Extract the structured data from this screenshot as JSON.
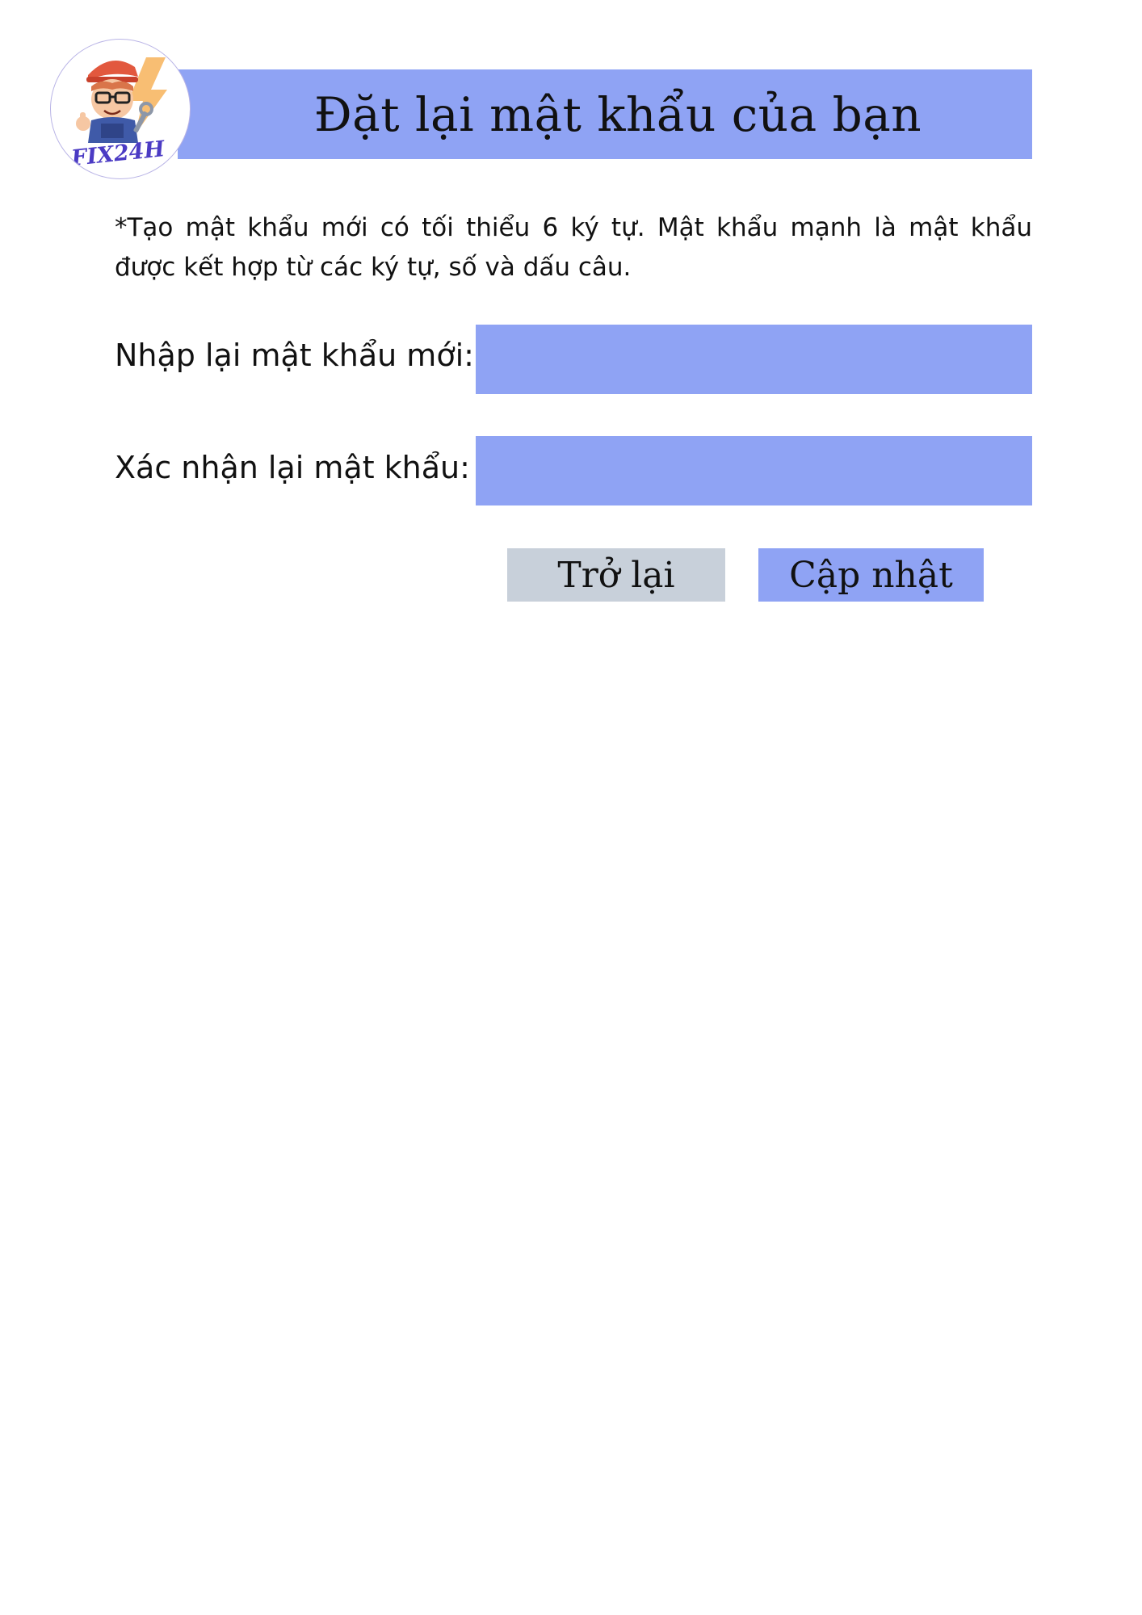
{
  "header": {
    "title": "Đặt lại mật khẩu của bạn"
  },
  "logo": {
    "text": "FIX24H",
    "icon": "mechanic-mascot-icon"
  },
  "instructions": {
    "text": "*Tạo mật khẩu mới có tối thiểu 6 ký tự. Mật khẩu mạnh là mật khẩu được kết hợp từ các ký tự, số và dấu câu."
  },
  "form": {
    "new_password": {
      "label": "Nhập lại mật khẩu mới:",
      "value": ""
    },
    "confirm_password": {
      "label": "Xác nhận lại mật khẩu:",
      "value": ""
    }
  },
  "buttons": {
    "back_label": "Trở lại",
    "update_label": "Cập nhật"
  },
  "colors": {
    "accent": "#8fa3f4",
    "secondary_button": "#c8d0da",
    "logo_text": "#4b3bc4"
  }
}
